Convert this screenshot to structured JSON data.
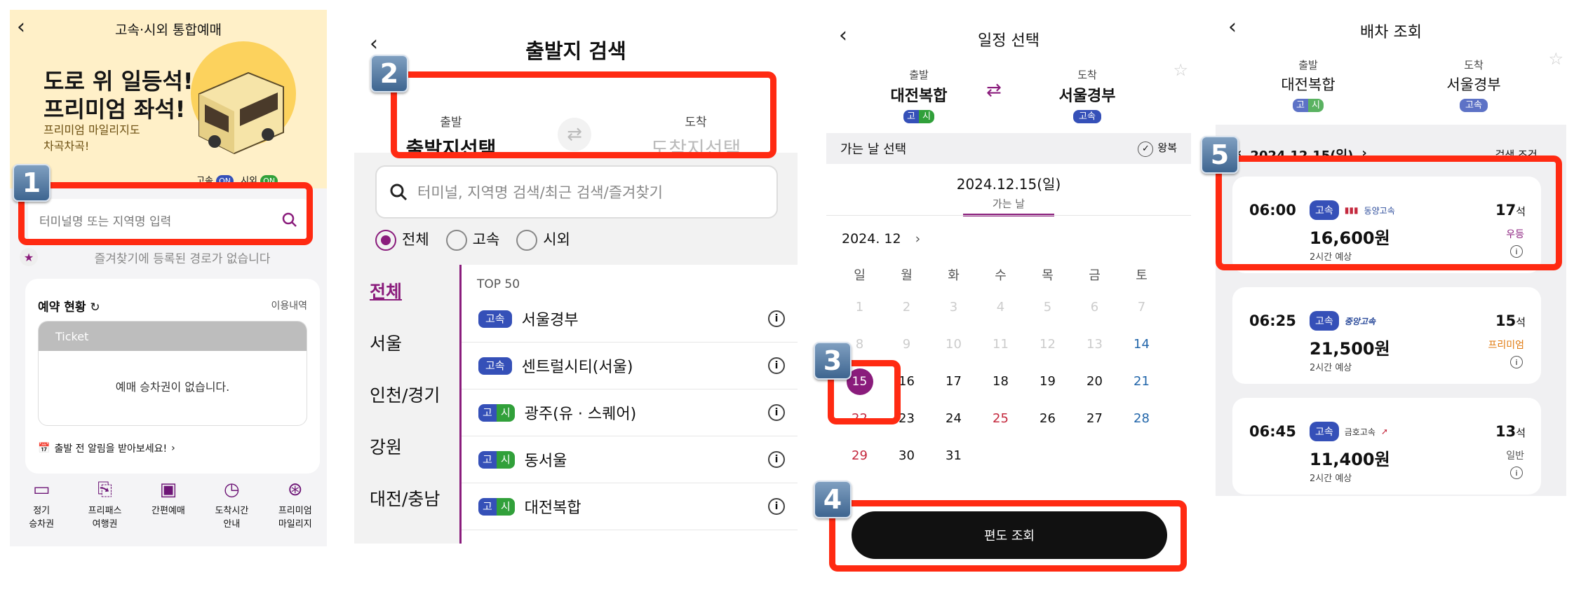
{
  "panel1": {
    "title": "고속·시외 통합예매",
    "promo_line1": "도로 위 일등석!",
    "promo_line2": "프리미엄 좌석!",
    "promo_sub1": "프리미엄 마일리지도",
    "promo_sub2": "차곡차곡!",
    "toggle_express": "고속",
    "toggle_intercity": "시외",
    "toggle_on": "ON",
    "search_placeholder": "터미널명 또는 지역명 입력",
    "favorites_empty": "즐겨찾기에 등록된 경로가 없습니다",
    "reservation_title": "예약 현황",
    "reservation_history": "이용내역",
    "ticket_label": "Ticket",
    "no_ticket": "예매 승차권이 없습니다.",
    "alert_text": "출발 전 알림을 받아보세요!",
    "menu": [
      {
        "line1": "정기",
        "line2": "승차권"
      },
      {
        "line1": "프리패스",
        "line2": "여행권"
      },
      {
        "line1": "간편예매",
        "line2": ""
      },
      {
        "line1": "도착시간",
        "line2": "안내"
      },
      {
        "line1": "프리미엄",
        "line2": "마일리지"
      }
    ]
  },
  "panel2": {
    "title": "출발지 검색",
    "depart_label": "출발",
    "depart_value": "출발지선택",
    "arrive_label": "도착",
    "arrive_value": "도착지선택",
    "search_placeholder": "터미널, 지역명 검색/최근 검색/즐겨찾기",
    "filter_all": "전체",
    "filter_express": "고속",
    "filter_intercity": "시외",
    "regions": [
      "전체",
      "서울",
      "인천/경기",
      "강원",
      "대전/충남"
    ],
    "top_label": "TOP 50",
    "terminals": [
      {
        "name": "서울경부",
        "type": "express"
      },
      {
        "name": "센트럴시티(서울)",
        "type": "express"
      },
      {
        "name": "광주(유 · 스퀘어)",
        "type": "both"
      },
      {
        "name": "동서울",
        "type": "both"
      },
      {
        "name": "대전복합",
        "type": "both"
      }
    ],
    "tag_express": "고속",
    "tag_go": "고",
    "tag_si": "시"
  },
  "panel3": {
    "title": "일정 선택",
    "depart_label": "출발",
    "depart_value": "대전복합",
    "arrive_label": "도착",
    "arrive_value": "서울경부",
    "bar_label": "가는 날 선택",
    "roundtrip": "왕복",
    "selected_date": "2024.12.15(일)",
    "selected_sub": "가는 날",
    "month": "2024. 12",
    "weekdays": [
      "일",
      "월",
      "화",
      "수",
      "목",
      "금",
      "토"
    ],
    "weeks": [
      [
        "1",
        "2",
        "3",
        "4",
        "5",
        "6",
        "7"
      ],
      [
        "8",
        "9",
        "10",
        "11",
        "12",
        "13",
        "14"
      ],
      [
        "15",
        "16",
        "17",
        "18",
        "19",
        "20",
        "21"
      ],
      [
        "22",
        "23",
        "24",
        "25",
        "26",
        "27",
        "28"
      ],
      [
        "29",
        "30",
        "31",
        "",
        "",
        "",
        ""
      ]
    ],
    "button": "편도 조회"
  },
  "panel4": {
    "title": "배차 조회",
    "depart_label": "출발",
    "depart_value": "대전복합",
    "arrive_label": "도착",
    "arrive_value": "서울경부",
    "date": "2024.12.15(일)",
    "filter": "검색 조건",
    "eta": "2시간 예상",
    "seat_unit": "석",
    "schedules": [
      {
        "time": "06:00",
        "company": "동양고속",
        "price": "16,600원",
        "seats": "17",
        "grade": "우등"
      },
      {
        "time": "06:25",
        "company": "중앙고속",
        "price": "21,500원",
        "seats": "15",
        "grade": "프리미엄"
      },
      {
        "time": "06:45",
        "company": "금호고속",
        "price": "11,400원",
        "seats": "13",
        "grade": "일반"
      }
    ]
  },
  "steps": [
    "1",
    "2",
    "3",
    "4",
    "5"
  ],
  "colors": {
    "accent": "#8a1c7c",
    "highlight": "#ff2a12",
    "express_tag": "#3550b8",
    "intercity_tag": "#31a03a",
    "sunday": "#c4283d",
    "saturday": "#2266aa"
  }
}
